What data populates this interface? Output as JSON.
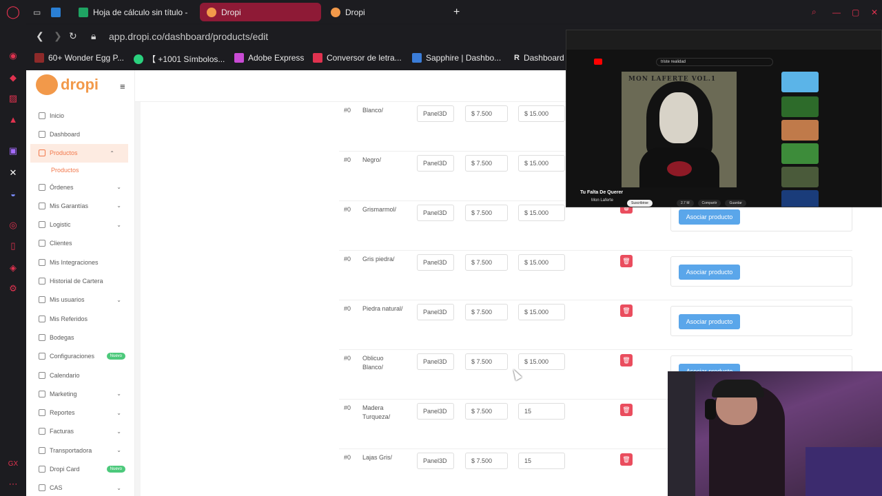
{
  "browser": {
    "tabs": [
      {
        "label": "Hoja de cálculo sin título - ",
        "active": false
      },
      {
        "label": "Dropi",
        "active": true
      },
      {
        "label": "Dropi",
        "active": false
      }
    ],
    "url": "app.dropi.co/dashboard/products/edit",
    "bookmarks": [
      "60+ Wonder Egg P...",
      "【 +1001 Símbolos...",
      "Adobe Express",
      "Conversor de letra...",
      "Sapphire | Dashbo...",
      "Dashboard"
    ]
  },
  "brand": {
    "name": "dropi",
    "accent": "#f2994a"
  },
  "sidebar": {
    "items": [
      {
        "label": "Inicio"
      },
      {
        "label": "Dashboard"
      },
      {
        "label": "Productos",
        "active": true,
        "chevron": "up"
      },
      {
        "label": "Productos",
        "sub": true
      },
      {
        "label": "Órdenes",
        "chevron": "down"
      },
      {
        "label": "Mis Garantías",
        "chevron": "down"
      },
      {
        "label": "Logistic",
        "chevron": "down"
      },
      {
        "label": "Clientes"
      },
      {
        "label": "Mis Integraciones"
      },
      {
        "label": "Historial de Cartera"
      },
      {
        "label": "Mis usuarios",
        "chevron": "down"
      },
      {
        "label": "Mis Referidos"
      },
      {
        "label": "Bodegas"
      },
      {
        "label": "Configuraciones",
        "badge": "Nuevo"
      },
      {
        "label": "Calendario"
      },
      {
        "label": "Marketing",
        "chevron": "down"
      },
      {
        "label": "Reportes",
        "chevron": "down"
      },
      {
        "label": "Facturas",
        "chevron": "down"
      },
      {
        "label": "Transportadora",
        "chevron": "down"
      },
      {
        "label": "Dropi Card",
        "badge": "Nuevo"
      },
      {
        "label": "CAS",
        "chevron": "down"
      }
    ]
  },
  "variants": [
    {
      "id": "#0",
      "name": "Blanco/",
      "supplier": "Panel3D",
      "cost": "$ 7.500",
      "price": "$ 15.000"
    },
    {
      "id": "#0",
      "name": "Negro/",
      "supplier": "Panel3D",
      "cost": "$ 7.500",
      "price": "$ 15.000"
    },
    {
      "id": "#0",
      "name": "Grismarmol/",
      "supplier": "Panel3D",
      "cost": "$ 7.500",
      "price": "$ 15.000",
      "assoc": "Asociar producto"
    },
    {
      "id": "#0",
      "name": "Gris piedra/",
      "supplier": "Panel3D",
      "cost": "$ 7.500",
      "price": "$ 15.000",
      "assoc": "Asociar producto"
    },
    {
      "id": "#0",
      "name": "Piedra natural/",
      "supplier": "Panel3D",
      "cost": "$ 7.500",
      "price": "$ 15.000",
      "assoc": "Asociar producto"
    },
    {
      "id": "#0",
      "name": "Oblicuo Blanco/",
      "supplier": "Panel3D",
      "cost": "$ 7.500",
      "price": "$ 15.000",
      "assoc": "Asociar producto"
    },
    {
      "id": "#0",
      "name": "Madera Turqueza/",
      "supplier": "Panel3D",
      "cost": "$ 7.500",
      "price": "15"
    },
    {
      "id": "#0",
      "name": "Lajas Gris/",
      "supplier": "Panel3D",
      "cost": "$ 7.500",
      "price": "15"
    }
  ],
  "youtube": {
    "title": "Tu Falta De Querer",
    "channel": "Mon Laferte",
    "subscribe": "Suscribirse",
    "search": "triste realidad",
    "album_text": "MON LAFERTE VOL.1",
    "actions": [
      "2.7 M",
      "Compartir",
      "Guardar"
    ]
  }
}
